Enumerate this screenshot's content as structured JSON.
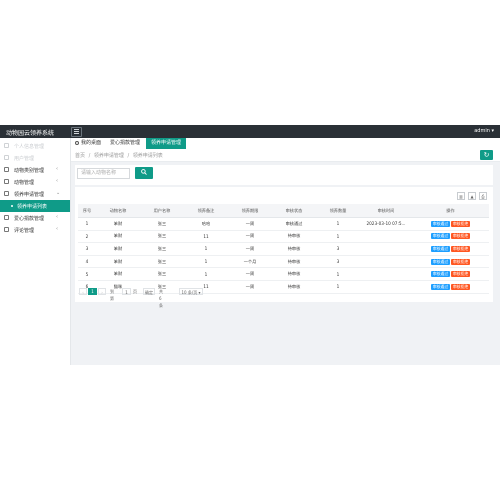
{
  "header": {
    "brand": "动物园云领养系统",
    "user": "admin ▾"
  },
  "sidebar": {
    "items": [
      {
        "label": "个人信息管理",
        "arrow": ""
      },
      {
        "label": "用户管理",
        "arrow": ""
      },
      {
        "label": "动物类别管理",
        "arrow": "‹"
      },
      {
        "label": "动物管理",
        "arrow": "‹"
      },
      {
        "label": "领养申请管理",
        "arrow": "⌄"
      },
      {
        "label": "领养申请列表",
        "arrow": ""
      },
      {
        "label": "爱心捐款管理",
        "arrow": "‹"
      },
      {
        "label": "评论管理",
        "arrow": "‹"
      }
    ]
  },
  "tabs": [
    {
      "label": "我的桌面"
    },
    {
      "label": "爱心捐款管理"
    },
    {
      "label": "领养申请管理"
    }
  ],
  "breadcrumb": [
    "首页",
    "/",
    "领养申请管理",
    "/",
    "领养申请列表"
  ],
  "search": {
    "placeholder": "请输入动物名称",
    "button_icon": "search-icon"
  },
  "table": {
    "headers": [
      "序号",
      "动物名称",
      "用户名称",
      "领养备注",
      "领养期限",
      "审核状态",
      "领养数量",
      "审核时间",
      "操作"
    ],
    "rows": [
      [
        "1",
        "笨财",
        "张三",
        "哈哈",
        "一周",
        "审核通过",
        "1",
        "2023-03-10 07:5..."
      ],
      [
        "2",
        "笨财",
        "张三",
        "11",
        "一周",
        "待审核",
        "1",
        ""
      ],
      [
        "3",
        "笨财",
        "张三",
        "1",
        "一周",
        "待审核",
        "3",
        ""
      ],
      [
        "4",
        "笨财",
        "张三",
        "1",
        "一个月",
        "待审核",
        "3",
        ""
      ],
      [
        "5",
        "笨财",
        "张三",
        "1",
        "一周",
        "待审核",
        "1",
        ""
      ],
      [
        "6",
        "猫咪",
        "张三",
        "11",
        "一周",
        "待审核",
        "1",
        ""
      ]
    ],
    "actions": {
      "pass": "审核通过",
      "reject": "审核拒绝"
    }
  },
  "pagination": {
    "prev": "‹",
    "current": "1",
    "next": "›",
    "goto_label": "到第",
    "page_input": "1",
    "page_unit": "页",
    "confirm": "确定",
    "total": "共 6 条",
    "per_page": "10 条/页 ▾"
  },
  "colors": {
    "accent": "#0f9b88",
    "topbar": "#2a3036",
    "pass": "#1e9fff",
    "reject": "#ff5722"
  }
}
